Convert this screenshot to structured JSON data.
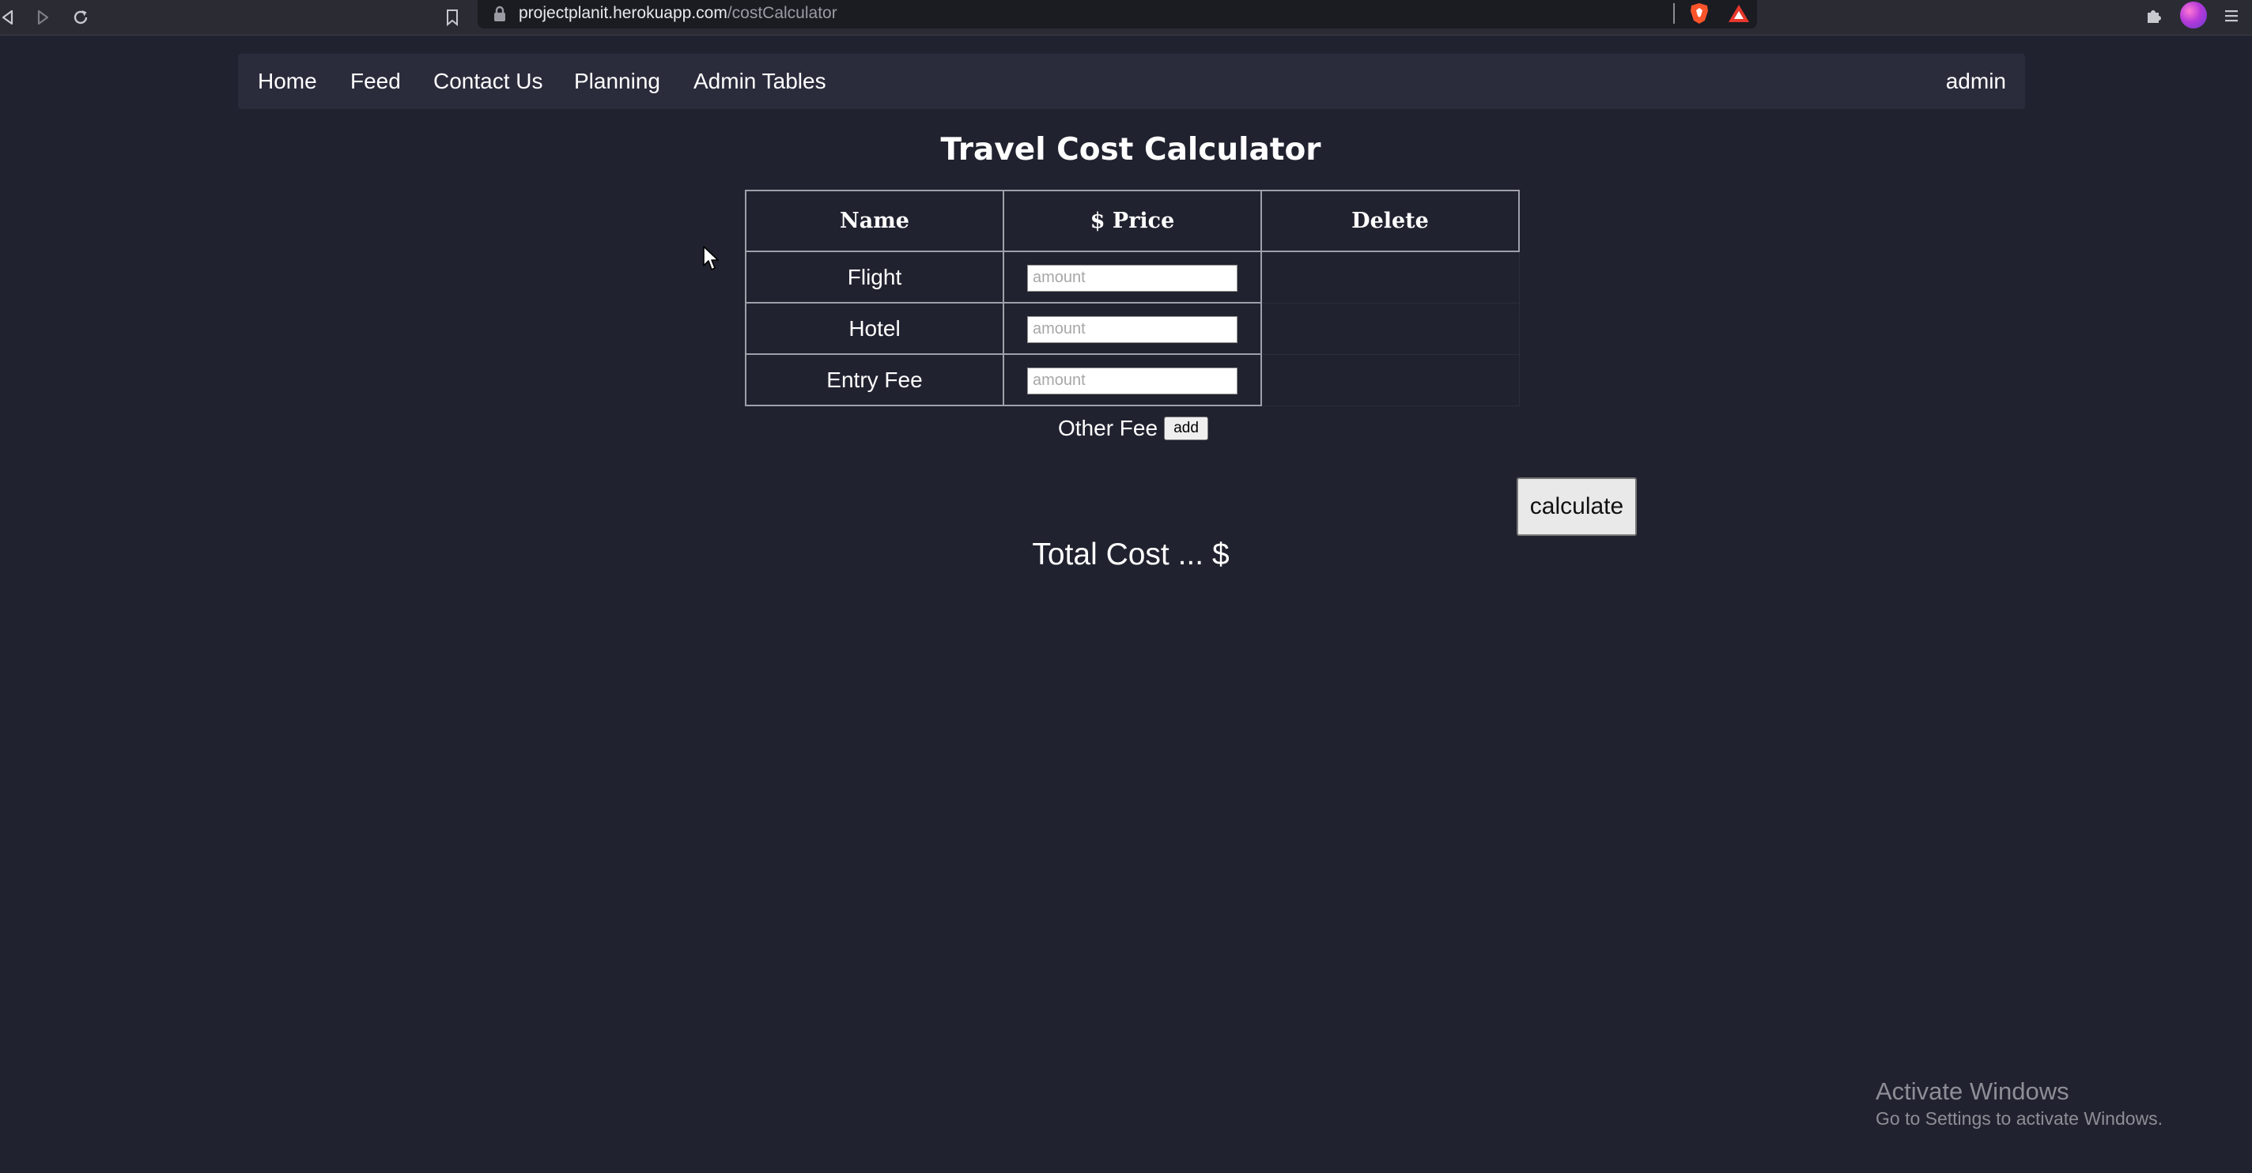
{
  "browser": {
    "url_host": "projectplanit.herokuapp.com",
    "url_path": "/costCalculator"
  },
  "navbar": {
    "links": [
      "Home",
      "Feed",
      "Contact Us",
      "Planning",
      "Admin Tables"
    ],
    "user": "admin"
  },
  "main": {
    "title": "Travel Cost Calculator",
    "table": {
      "headers": [
        "Name",
        "$ Price",
        "Delete"
      ],
      "rows": [
        {
          "name": "Flight",
          "price_placeholder": "amount",
          "price_value": ""
        },
        {
          "name": "Hotel",
          "price_placeholder": "amount",
          "price_value": ""
        },
        {
          "name": "Entry Fee",
          "price_placeholder": "amount",
          "price_value": ""
        }
      ]
    },
    "other_fee": {
      "label": "Other Fee",
      "add_label": "add"
    },
    "calculate_label": "calculate",
    "total_cost": "Total Cost ... $"
  },
  "watermark": {
    "title": "Activate Windows",
    "subtitle": "Go to Settings to activate Windows."
  },
  "icons": {
    "back": "back-icon",
    "forward": "forward-icon",
    "reload": "reload-icon",
    "bookmark": "bookmark-icon",
    "lock": "lock-icon",
    "brave": "brave-shield-icon",
    "rewards": "brave-rewards-icon",
    "extensions": "puzzle-icon",
    "menu": "hamburger-icon"
  },
  "colors": {
    "page_background": "#21222f",
    "navbar_background": "#2a2c3c",
    "browser_bar": "#2b2c33",
    "text": "#ffffff",
    "table_border": "#9ea0aa"
  }
}
